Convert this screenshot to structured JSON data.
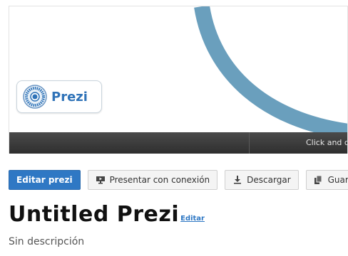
{
  "preview": {
    "logo_label": "Prezi",
    "hint_text": "Click and d",
    "arc_color": "#6a9fbd"
  },
  "toolbar": {
    "edit_label": "Editar prezi",
    "present_label": "Presentar con conexión",
    "download_label": "Descargar",
    "save_label": "Guar"
  },
  "doc": {
    "title": "Untitled Prezi",
    "edit_link": "Editar",
    "description": "Sin descripción"
  },
  "colors": {
    "accent": "#2f78c4",
    "hint_bar": "#3a3a3a"
  }
}
